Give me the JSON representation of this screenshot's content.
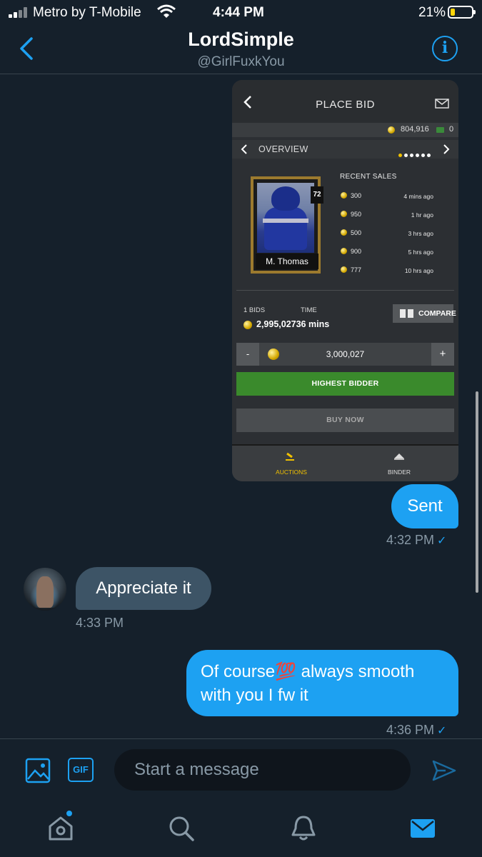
{
  "status_bar": {
    "carrier": "Metro by T-Mobile",
    "time": "4:44 PM",
    "battery": "21%"
  },
  "header": {
    "title": "LordSimple",
    "handle": "@GirlFuxkYou"
  },
  "shared_image": {
    "title": "PLACE BID",
    "coins": "804,916",
    "bills": "0",
    "nav_label": "OVERVIEW",
    "player": {
      "ovr": "72",
      "name": "M. Thomas"
    },
    "recent_sales_title": "RECENT SALES",
    "recent_sales": [
      {
        "amount": "300",
        "ago": "4 mins ago"
      },
      {
        "amount": "950",
        "ago": "1 hr ago"
      },
      {
        "amount": "500",
        "ago": "3 hrs ago"
      },
      {
        "amount": "900",
        "ago": "5 hrs ago"
      },
      {
        "amount": "777",
        "ago": "10 hrs ago"
      }
    ],
    "bids_label": "1 BIDS",
    "time_label": "TIME",
    "bid_value": "2,995,02736 mins",
    "compare_label": "COMPARE",
    "stepper": {
      "minus": "-",
      "value": "3,000,027",
      "plus": "+"
    },
    "highest_bidder": "HIGHEST BIDDER",
    "buy_now": "BUY NOW",
    "tabs": [
      {
        "label": "AUCTIONS",
        "active": true
      },
      {
        "label": "BINDER",
        "active": false
      }
    ]
  },
  "messages": [
    {
      "from": "me",
      "text": "Sent",
      "time": "4:32 PM"
    },
    {
      "from": "them",
      "text": "Appreciate it",
      "time": "4:33 PM"
    },
    {
      "from": "me",
      "text": "Of course💯 always smooth with you I fw it",
      "time": "4:36 PM"
    }
  ],
  "composer": {
    "placeholder": "Start a message",
    "gif_label": "GIF"
  },
  "colors": {
    "accent": "#1da1f2",
    "background": "#15202b",
    "incoming_bubble": "#3d5466",
    "divider": "#38444d"
  },
  "icons": [
    "back-chevron-icon",
    "info-icon",
    "image-icon",
    "send-icon",
    "home-icon",
    "search-icon",
    "bell-icon",
    "mail-icon"
  ]
}
